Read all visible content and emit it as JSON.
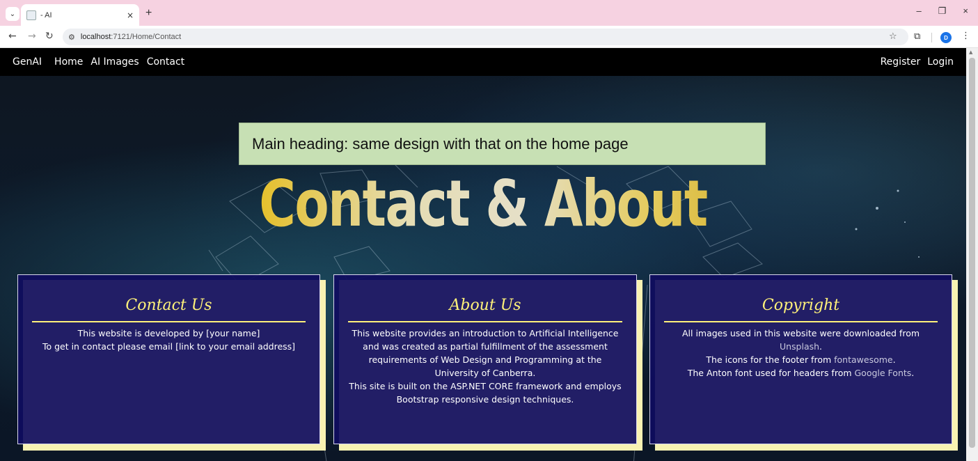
{
  "browser": {
    "tab_title": "- AI",
    "tab_close": "×",
    "new_tab": "+",
    "url_host": "localhost",
    "url_path": ":7121/Home/Contact",
    "controls": {
      "minimize": "–",
      "restore": "❐",
      "close": "×"
    },
    "profile_initial": "D"
  },
  "nav": {
    "brand": "GenAI",
    "links": [
      "Home",
      "AI Images",
      "Contact"
    ],
    "right_links": [
      "Register",
      "Login"
    ]
  },
  "annotation": "Main heading: same design with that on the home page",
  "heading": "Contact & About",
  "cards": {
    "contact": {
      "title": "Contact Us",
      "lines": [
        "This website is developed by [your name]",
        "To get in contact please email [link to your email address]"
      ]
    },
    "about": {
      "title": "About Us",
      "lines": [
        "This website provides an introduction to Artificial Intelligence and was created as partial fulfillment of the assessment requirements of Web Design and Programming at the University of Canberra.",
        "This site is built on the ASP.NET CORE framework and employs Bootstrap responsive design techniques."
      ]
    },
    "copyright": {
      "title": "Copyright",
      "line1_prefix": "All images used in this website were downloaded from",
      "line1_link": "Unsplash",
      "line1_suffix": ".",
      "line2_prefix": "The icons for the footer from ",
      "line2_link": "fontawesome",
      "line2_suffix": ".",
      "line3_prefix": "The Anton font used for headers from ",
      "line3_link": "Google Fonts",
      "line3_suffix": "."
    }
  },
  "colors": {
    "card_bg": "#0f0c5f",
    "card_shadow": "#f8f2b2",
    "card_title": "#fff27a",
    "annotation_bg": "#c7e0b4",
    "nav_bg": "#000000",
    "tabstrip_bg": "#f6d2e1"
  },
  "icons": {
    "tab_search": "chevron-down-icon",
    "back": "arrow-left-icon",
    "forward": "arrow-right-icon",
    "reload": "reload-icon",
    "site_info": "tune-icon",
    "bookmark": "star-icon",
    "extensions": "puzzle-icon",
    "menu": "kebab-menu-icon"
  }
}
